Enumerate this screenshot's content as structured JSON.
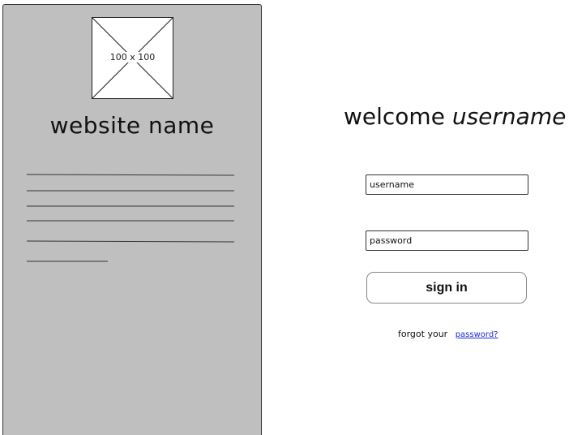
{
  "sidebar": {
    "logo_placeholder": "100 x 100",
    "site_name": "website name"
  },
  "login": {
    "welcome_prefix": "welcome",
    "welcome_user": "username",
    "username_placeholder": "username",
    "password_placeholder": "password",
    "signin_label": "sign in",
    "forgot_prefix": "forgot your",
    "forgot_link": "password?"
  },
  "colors": {
    "sidebar_bg": "#bfbfbf",
    "link": "#1a2dd4"
  }
}
